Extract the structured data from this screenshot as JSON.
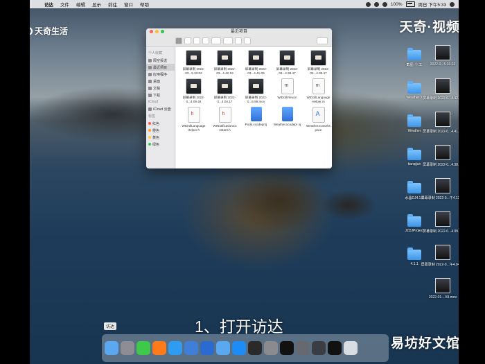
{
  "menubar": {
    "app": "访达",
    "items": [
      "文件",
      "编辑",
      "显示",
      "前往",
      "窗口",
      "帮助"
    ],
    "status": "100%",
    "clock": "周日 下午5:33"
  },
  "watermarks": {
    "left": "天奇生活",
    "right": "天奇·视频",
    "bottom": "易坊好文馆"
  },
  "caption": "1、打开访达",
  "finder": {
    "title": "最近项目",
    "sidebar": {
      "favorites_header": "个人收藏",
      "favorites": [
        "隔空投送",
        "最近项目",
        "应用程序",
        "桌面",
        "文稿",
        "下载"
      ],
      "icloud_header": "iCloud",
      "icloud": [
        "iCloud 云盘"
      ],
      "tags_header": "标签",
      "tags": [
        {
          "label": "红色",
          "color": "#ff5b55"
        },
        {
          "label": "橙色",
          "color": "#ff9f2e"
        },
        {
          "label": "黄色",
          "color": "#ffd23a"
        },
        {
          "label": "绿色",
          "color": "#3fc855"
        }
      ]
    },
    "files": [
      {
        "label": "屏幕录制 2022-03...5.33.02",
        "kind": "mov"
      },
      {
        "label": "屏幕录制 2022-03...4.42.19",
        "kind": "mov"
      },
      {
        "label": "屏幕录制 2022-03...4.41.09",
        "kind": "mov"
      },
      {
        "label": "屏幕录制 2022-03...4.38.47",
        "kind": "mov"
      },
      {
        "label": "屏幕录制 2022-03...4.38.47",
        "kind": "mov"
      },
      {
        "label": "屏幕录制 2022-0...4.09.46",
        "kind": "mov"
      },
      {
        "label": "屏幕录制 2022-0...4.04.17",
        "kind": "mov"
      },
      {
        "label": "屏幕录制 2022-0...6.59.mov",
        "kind": "mov"
      },
      {
        "label": "WIDollView.m",
        "kind": "doc"
      },
      {
        "label": "WIDollLanguage Helper.m",
        "kind": "doc"
      },
      {
        "label": "WIDollLanguage Helper.h",
        "kind": "hdr"
      },
      {
        "label": "WINotificationCo nstant.h",
        "kind": "hdr"
      },
      {
        "label": "Pods.xcodeproj",
        "kind": "xproj"
      },
      {
        "label": "Weather.xcodepr oj",
        "kind": "xproj"
      },
      {
        "label": "Weather.xcworks pace",
        "kind": "xws"
      }
    ]
  },
  "desktop_left_column": [
    {
      "label": "截图 个 工",
      "kind": "folder"
    },
    {
      "label": "Weather 2",
      "kind": "folder"
    },
    {
      "label": "Weather",
      "kind": "folder"
    },
    {
      "label": "tianqijun",
      "kind": "folder"
    },
    {
      "label": "水晶DJ4.1.5",
      "kind": "folder"
    },
    {
      "label": "JZDJProject",
      "kind": "folder"
    },
    {
      "label": "4.1.1",
      "kind": "folder"
    }
  ],
  "desktop_right_column": [
    {
      "label": "2022-0...5.33.02",
      "kind": "thumb"
    },
    {
      "label": "屏幕录制 2022-0...4.42.19",
      "kind": "thumb"
    },
    {
      "label": "屏幕录制 2022-0...4.41.09",
      "kind": "thumb"
    },
    {
      "label": "屏幕录制 2022-0...4.38.47",
      "kind": "thumb"
    },
    {
      "label": "屏幕录制 2022-0...午4.12.19",
      "kind": "thumb"
    },
    {
      "label": "屏幕录制 2022-0...4.09.46",
      "kind": "thumb"
    },
    {
      "label": "屏幕录制 2022-0...午4.04.17",
      "kind": "thumb"
    },
    {
      "label": "2022-01....59.mov",
      "kind": "thumb"
    }
  ],
  "dock": {
    "tooltip": "访达",
    "apps": [
      {
        "name": "finder-icon",
        "color": "#5aa8ef"
      },
      {
        "name": "launchpad-icon",
        "color": "#8d8d93"
      },
      {
        "name": "wechat-icon",
        "color": "#3ec94a"
      },
      {
        "name": "firefox-icon",
        "color": "#ff7a1a"
      },
      {
        "name": "safari-icon",
        "color": "#2d9cf1"
      },
      {
        "name": "xcode-icon",
        "color": "#3f7fd8"
      },
      {
        "name": "xcode-dev-icon",
        "color": "#2b6ad0"
      },
      {
        "name": "files-icon",
        "color": "#5aa8ef"
      },
      {
        "name": "appstore-icon",
        "color": "#1d8cf6"
      },
      {
        "name": "terminal-icon",
        "color": "#2a2a2a"
      },
      {
        "name": "system-preferences-icon",
        "color": "#8a8a8f"
      },
      {
        "name": "qq-icon",
        "color": "#111111"
      },
      {
        "name": "instruments-icon",
        "color": "#666a70"
      },
      {
        "name": "quicktime-icon",
        "color": "#3a3d44"
      },
      {
        "name": "qq-2-icon",
        "color": "#111111"
      },
      {
        "name": "trash-icon",
        "color": "#d9dde3"
      }
    ]
  }
}
